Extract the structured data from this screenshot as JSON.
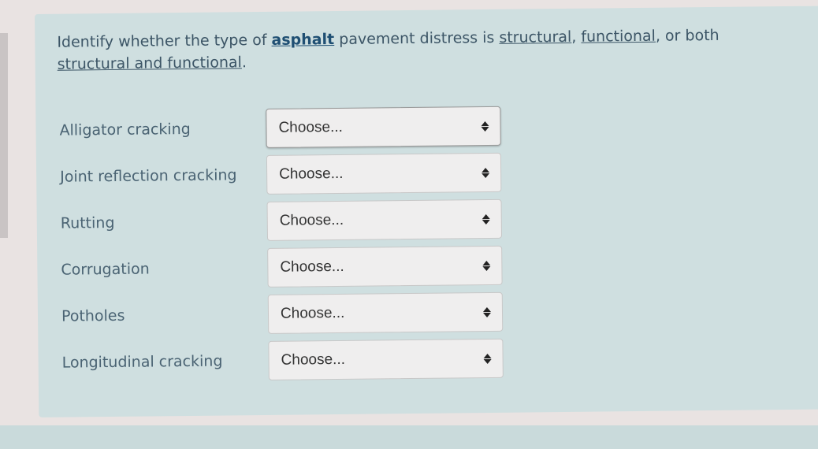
{
  "question": {
    "parts": [
      {
        "text": "Identify whether the type of ",
        "style": "plain"
      },
      {
        "text": "asphalt",
        "style": "bold-link"
      },
      {
        "text": " pavement distress is ",
        "style": "plain"
      },
      {
        "text": "structural",
        "style": "underline"
      },
      {
        "text": ", ",
        "style": "plain"
      },
      {
        "text": "functional",
        "style": "underline"
      },
      {
        "text": ", or both ",
        "style": "plain"
      },
      {
        "text": "structural and functional",
        "style": "underline"
      },
      {
        "text": ".",
        "style": "plain"
      }
    ]
  },
  "rows": [
    {
      "label": "Alligator cracking",
      "select": {
        "value": "Choose...",
        "icon": "up-down-arrows-icon"
      }
    },
    {
      "label": "Joint reflection cracking",
      "select": {
        "value": "Choose...",
        "icon": "up-down-arrows-icon"
      }
    },
    {
      "label": "Rutting",
      "select": {
        "value": "Choose...",
        "icon": "up-down-arrows-icon"
      }
    },
    {
      "label": "Corrugation",
      "select": {
        "value": "Choose...",
        "icon": "up-down-arrows-icon"
      }
    },
    {
      "label": "Potholes",
      "select": {
        "value": "Choose...",
        "icon": "up-down-arrows-icon"
      }
    },
    {
      "label": "Longitudinal cracking",
      "select": {
        "value": "Choose...",
        "icon": "up-down-arrows-icon"
      }
    }
  ],
  "colors": {
    "panel_bg": "#cfdfe0",
    "page_bg": "#e9e3e2",
    "text": "#4a6373",
    "link": "#1f4f73"
  }
}
